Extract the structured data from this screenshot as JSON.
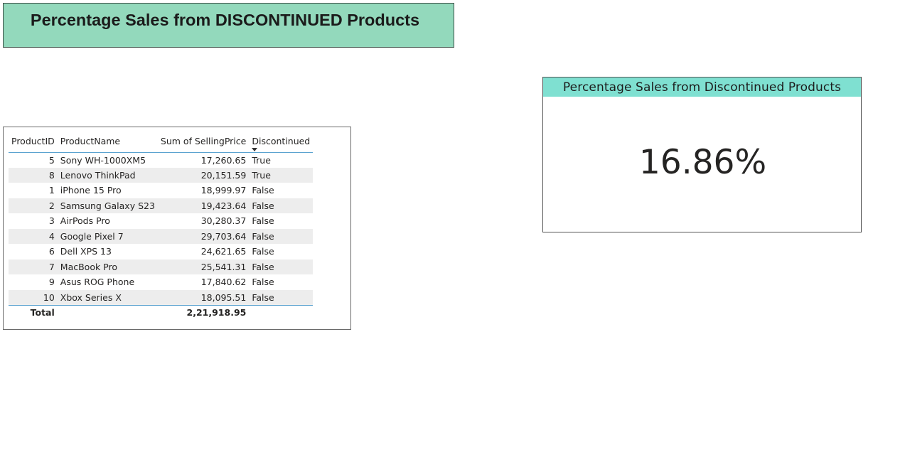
{
  "report_title": "Percentage Sales from DISCONTINUED Products",
  "table": {
    "columns": [
      "ProductID",
      "ProductName",
      "Sum of SellingPrice",
      "Discontinued"
    ],
    "sorted_column": "Discontinued",
    "sort_direction": "descending",
    "rows": [
      {
        "id": "5",
        "name": "Sony WH-1000XM5",
        "price": "17,260.65",
        "discontinued": "True"
      },
      {
        "id": "8",
        "name": "Lenovo ThinkPad",
        "price": "20,151.59",
        "discontinued": "True"
      },
      {
        "id": "1",
        "name": "iPhone 15 Pro",
        "price": "18,999.97",
        "discontinued": "False"
      },
      {
        "id": "2",
        "name": "Samsung Galaxy S23",
        "price": "19,423.64",
        "discontinued": "False"
      },
      {
        "id": "3",
        "name": "AirPods Pro",
        "price": "30,280.37",
        "discontinued": "False"
      },
      {
        "id": "4",
        "name": "Google Pixel 7",
        "price": "29,703.64",
        "discontinued": "False"
      },
      {
        "id": "6",
        "name": "Dell XPS 13",
        "price": "24,621.65",
        "discontinued": "False"
      },
      {
        "id": "7",
        "name": "MacBook Pro",
        "price": "25,541.31",
        "discontinued": "False"
      },
      {
        "id": "9",
        "name": "Asus ROG Phone",
        "price": "17,840.62",
        "discontinued": "False"
      },
      {
        "id": "10",
        "name": "Xbox Series X",
        "price": "18,095.51",
        "discontinued": "False"
      }
    ],
    "total_label": "Total",
    "total_price": "2,21,918.95"
  },
  "card": {
    "title": "Percentage Sales from Discontinued Products",
    "value": "16.86%"
  },
  "colors": {
    "title_banner_bg": "#93d9bc",
    "card_header_bg": "#7fe0d1",
    "row_stripe": "#ededed",
    "table_rule": "#5ba3d0"
  }
}
